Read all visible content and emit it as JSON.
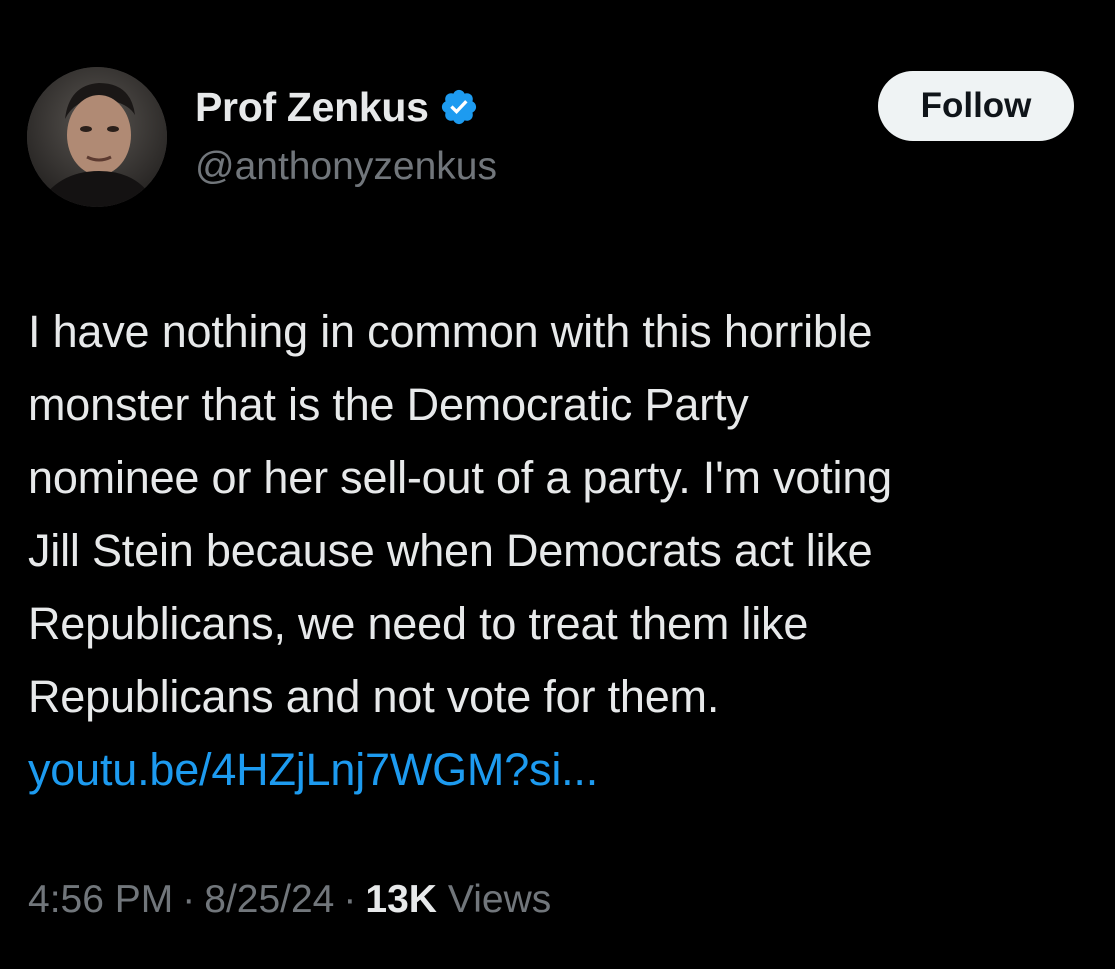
{
  "author": {
    "display_name": "Prof Zenkus",
    "handle": "@anthonyzenkus",
    "verified": true,
    "verified_icon": "verified-badge-icon",
    "accent_color": "#1d9bf0"
  },
  "follow_button": {
    "label": "Follow"
  },
  "tweet": {
    "text_lines": [
      "I have nothing in common with this horrible",
      "monster that is the Democratic Party",
      "nominee or her sell-out of a party. I'm voting",
      "Jill Stein because when Democrats act like",
      "Republicans, we need to treat them like",
      "Republicans and not vote for them."
    ],
    "link_text": "youtu.be/4HZjLnj7WGM?si..."
  },
  "meta": {
    "time": "4:56 PM",
    "separator": "·",
    "date": "8/25/24",
    "views_count": "13K",
    "views_label": "Views"
  },
  "colors": {
    "background": "#000000",
    "primary_text": "#e7e9ea",
    "secondary_text": "#71767b",
    "link": "#1d9bf0",
    "button_bg": "#eff3f4"
  }
}
